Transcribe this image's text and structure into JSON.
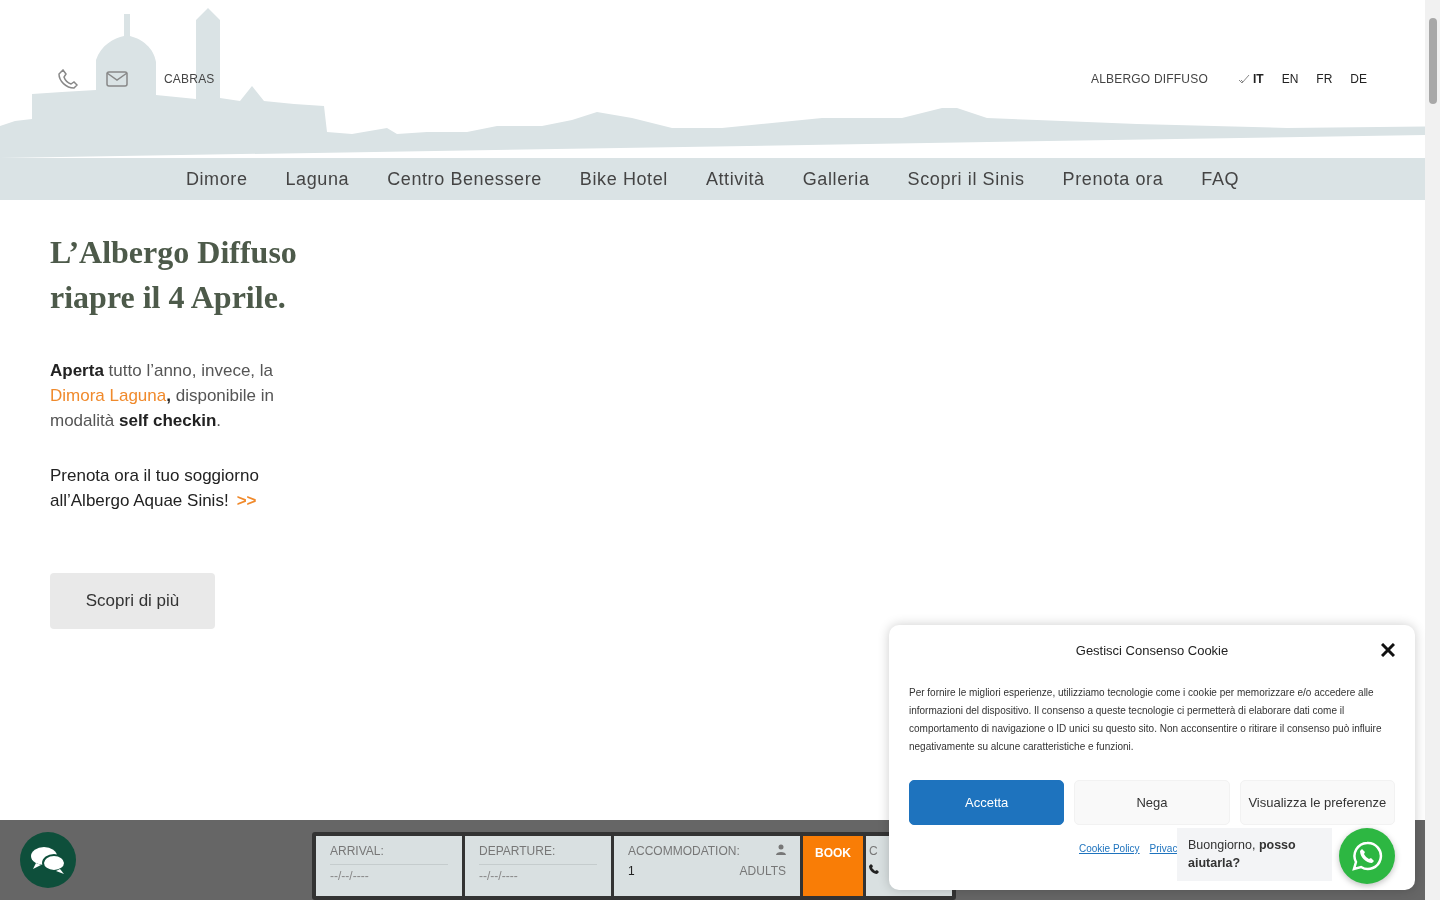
{
  "header": {
    "location": "CABRAS",
    "tagline": "ALBERGO DIFFUSO",
    "languages": [
      {
        "code": "IT",
        "selected": true
      },
      {
        "code": "EN",
        "selected": false
      },
      {
        "code": "FR",
        "selected": false
      },
      {
        "code": "DE",
        "selected": false
      }
    ]
  },
  "nav": [
    "Dimore",
    "Laguna",
    "Centro Benessere",
    "Bike Hotel",
    "Attività",
    "Galleria",
    "Scopri il Sinis",
    "Prenota ora",
    "FAQ"
  ],
  "hero": {
    "title": "L’Albergo Diffuso riapre il 4 Aprile.",
    "intro": [
      {
        "kind": "text",
        "text": "**Aperta** tutto l’anno, invece, la "
      },
      {
        "kind": "link",
        "text": "Dimora Laguna"
      },
      {
        "kind": "text",
        "text": "**,** disponibile in modalità **self checkin**."
      }
    ],
    "cta": [
      {
        "kind": "text",
        "text": "Prenota ora il tuo soggiorno all’Albergo Aquae Sinis!"
      },
      {
        "kind": "link",
        "text": ">>"
      }
    ],
    "button": "Scopri di più"
  },
  "booking": [
    {
      "kind": "date",
      "label": "ARRIVAL:",
      "placeholder": "--/--/----"
    },
    {
      "kind": "date",
      "label": "DEPARTURE:",
      "placeholder": "--/--/----"
    },
    {
      "kind": "guests",
      "label": "ACCOMMODATION:",
      "value": "1",
      "unit": "ADULTS"
    },
    {
      "kind": "book",
      "label": "BOOK"
    },
    {
      "kind": "partial",
      "label": "C"
    }
  ],
  "cookie": {
    "title": "Gestisci Consenso Cookie",
    "body": "Per fornire le migliori esperienze, utilizziamo tecnologie come i cookie per memorizzare e/o accedere alle informazioni del dispositivo. Il consenso a queste tecnologie ci permetterà di elaborare dati come il comportamento di navigazione o ID unici su questo sito. Non acconsentire o ritirare il consenso può influire negativamente su alcune caratteristiche e funzioni.",
    "buttons": [
      {
        "label": "Accetta",
        "kind": "primary"
      },
      {
        "label": "Nega",
        "kind": "secondary"
      },
      {
        "label": "Visualizza le preferenze",
        "kind": "secondary"
      }
    ],
    "links": [
      "Cookie Policy",
      "Privac"
    ]
  },
  "whatsapp": {
    "message": "Buongiorno, **posso aiutarla?**"
  }
}
